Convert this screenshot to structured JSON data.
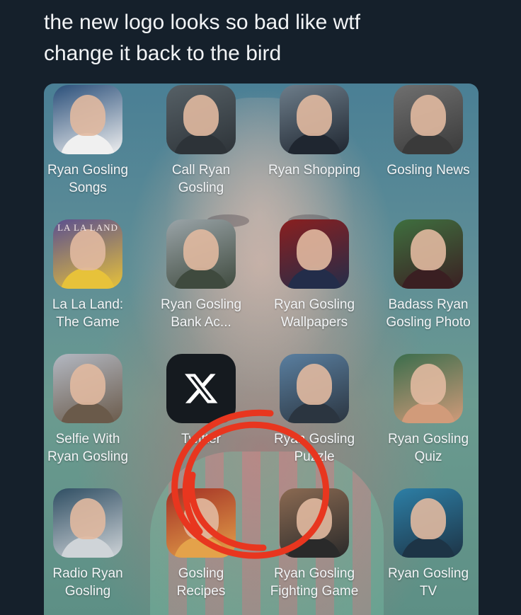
{
  "caption": "the new logo looks so bad like wtf\nchange it back to the bird",
  "apps": [
    {
      "label": "Ryan Gosling\nSongs",
      "icon": "ryan-gosling-songs-icon",
      "colors": [
        "#2a4f7a",
        "#f0f0f0"
      ]
    },
    {
      "label": "Call Ryan\nGosling",
      "icon": "call-ryan-gosling-icon",
      "colors": [
        "#566066",
        "#2d3338"
      ]
    },
    {
      "label": "Ryan Shopping",
      "icon": "ryan-shopping-icon",
      "colors": [
        "#6d7d8a",
        "#1f2630"
      ]
    },
    {
      "label": "Gosling News",
      "icon": "gosling-news-icon",
      "colors": [
        "#6f6f6f",
        "#3a3a3a"
      ]
    },
    {
      "label": "La La Land:\nThe Game",
      "icon": "la-la-land-icon",
      "colors": [
        "#5b4f8f",
        "#e7c23a"
      ],
      "icon_text": "LA LA LAND"
    },
    {
      "label": "Ryan Gosling\nBank Ac...",
      "icon": "ryan-gosling-bank-icon",
      "colors": [
        "#9aa4a8",
        "#3f4a3e"
      ]
    },
    {
      "label": "Ryan Gosling\nWallpapers",
      "icon": "ryan-gosling-wallpapers-icon",
      "colors": [
        "#8a1f1f",
        "#232d4a"
      ]
    },
    {
      "label": "Badass Ryan\nGosling Photo",
      "icon": "badass-ryan-gosling-icon",
      "colors": [
        "#3f6f3f",
        "#3a1f22"
      ]
    },
    {
      "label": "Selfie With\nRyan Gosling",
      "icon": "selfie-with-ryan-gosling-icon",
      "colors": [
        "#b3b8c2",
        "#6a5a4a"
      ]
    },
    {
      "label": "Twitter",
      "icon": "x-logo-icon",
      "colors": [
        "#151a1f",
        "#ffffff"
      ],
      "icon_text": "𝕏"
    },
    {
      "label": "Ryan Gosling\nPuzzle",
      "icon": "ryan-gosling-puzzle-icon",
      "colors": [
        "#5a7fa0",
        "#2b3540"
      ]
    },
    {
      "label": "Ryan Gosling\nQuiz",
      "icon": "ryan-gosling-quiz-icon",
      "colors": [
        "#3b6d4c",
        "#d19b7a"
      ]
    },
    {
      "label": "Radio Ryan\nGosling",
      "icon": "radio-ryan-gosling-icon",
      "colors": [
        "#2f4e63",
        "#cfd4d8"
      ]
    },
    {
      "label": "Gosling\nRecipes",
      "icon": "gosling-recipes-icon",
      "colors": [
        "#a33025",
        "#e4a24a"
      ]
    },
    {
      "label": "Ryan Gosling\nFighting Game",
      "icon": "ryan-gosling-fighting-game-icon",
      "colors": [
        "#8b6a52",
        "#2a2a2a"
      ]
    },
    {
      "label": "Ryan Gosling\nTV",
      "icon": "ryan-gosling-tv-icon",
      "colors": [
        "#2d7fa6",
        "#1d3446"
      ]
    }
  ],
  "annotation_color": "#e8361f"
}
